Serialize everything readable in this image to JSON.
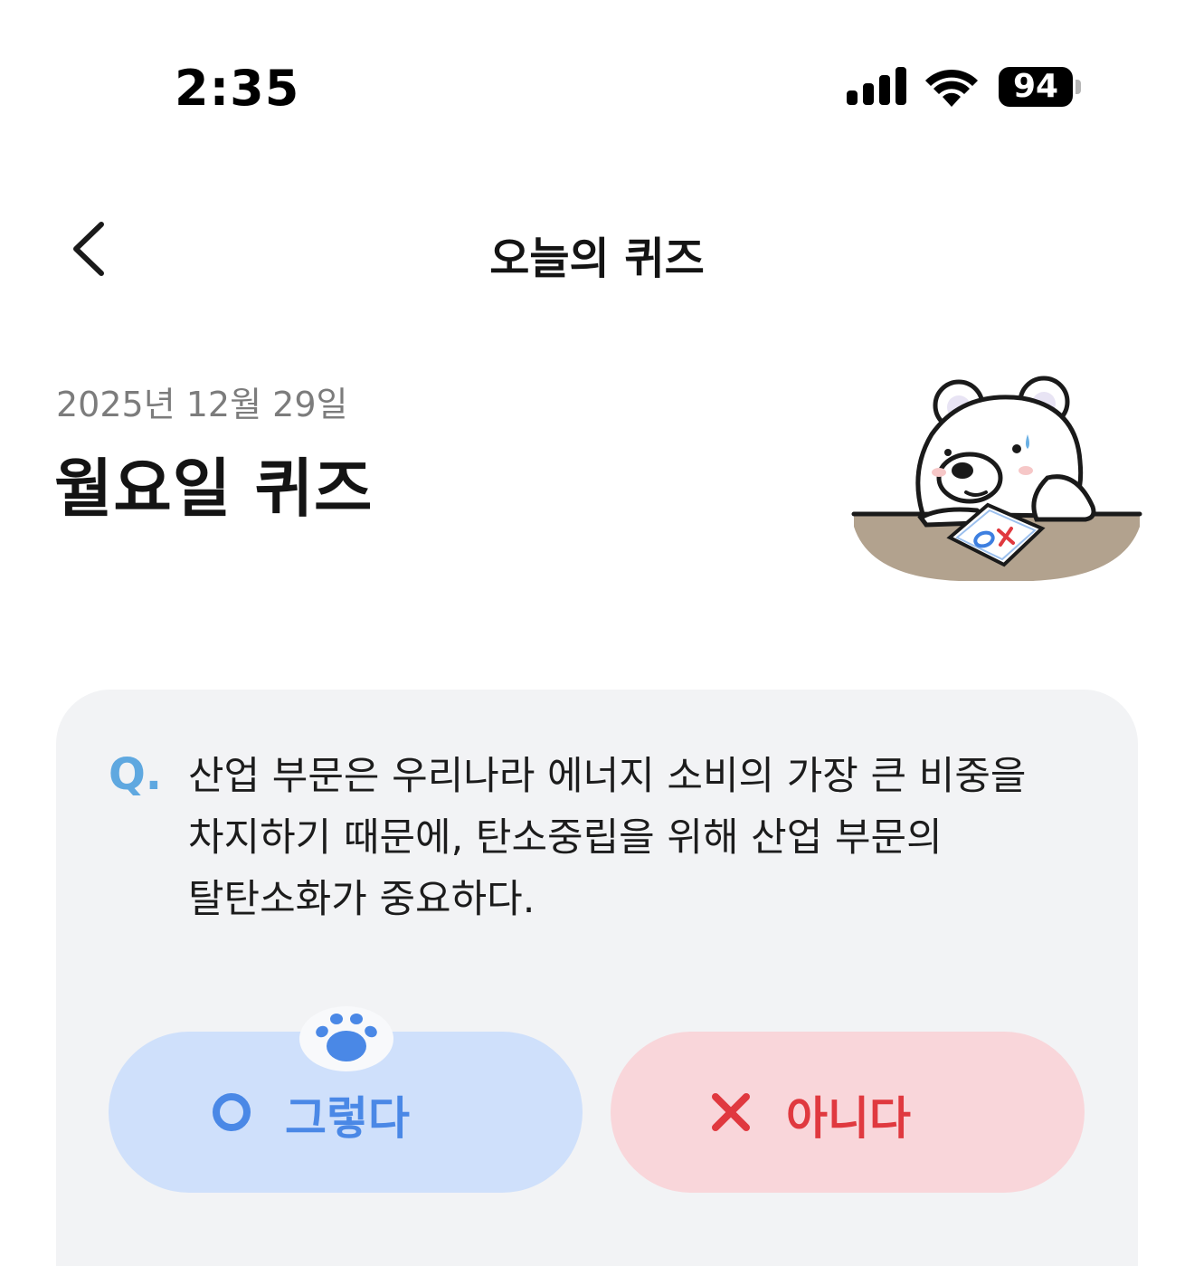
{
  "status_bar": {
    "time": "2:35",
    "battery": "94",
    "icons": [
      "cellular-signal-icon",
      "wifi-icon",
      "battery-icon"
    ]
  },
  "nav": {
    "title": "오늘의 퀴즈",
    "back_icon": "chevron-left-icon"
  },
  "header": {
    "date": "2025년 12월 29일",
    "title": "월요일 퀴즈",
    "mascot": "polar-bear-mascot-with-ox-paper"
  },
  "quiz": {
    "q_label": "Q.",
    "question_lines": [
      "산업 부문은 우리나라 에너지 소비의 가장 큰 비중을",
      "차지하기 때문에, 탄소중립을 위해 산업 부문의",
      "탈탄소화가 중요하다."
    ],
    "answers": {
      "yes": {
        "label": "그렇다",
        "icon": "circle-o-icon"
      },
      "no": {
        "label": "아니다",
        "icon": "x-mark-icon"
      }
    },
    "badge_icon": "paw-icon"
  },
  "colors": {
    "yes_bg": "#cfe0fb",
    "yes_fg": "#4a88e6",
    "no_bg": "#f9d6da",
    "no_fg": "#e0393f",
    "card_bg": "#f2f3f5",
    "q_label": "#5fa8e0"
  }
}
